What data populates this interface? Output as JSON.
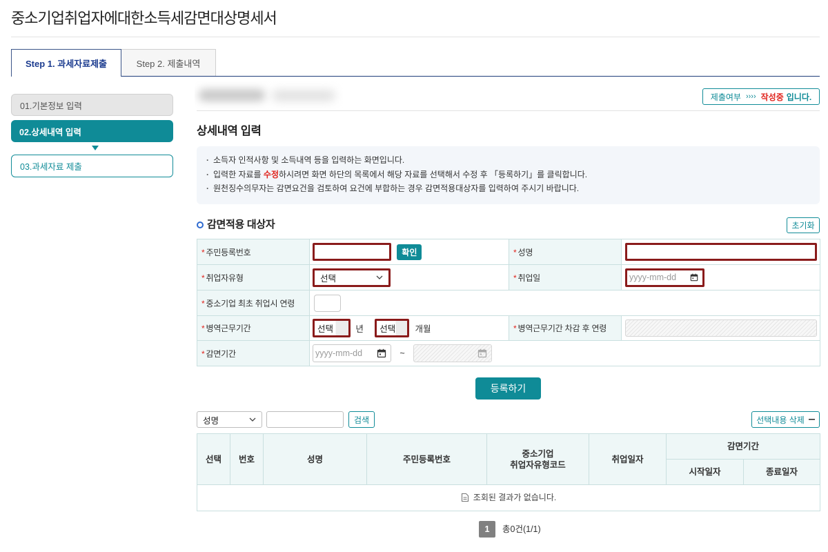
{
  "page": {
    "title": "중소기업취업자에대한소득세감면대상명세서"
  },
  "tabs": [
    {
      "label": "Step 1. 과세자료제출",
      "active": true
    },
    {
      "label": "Step 2. 제출내역",
      "active": false
    }
  ],
  "steps": [
    {
      "label": "01.기본정보 입력",
      "current": false
    },
    {
      "label": "02.상세내역 입력",
      "current": true
    },
    {
      "label": "03.과세자료 제출",
      "current": false
    }
  ],
  "status": {
    "label": "제출여부",
    "arrows": "››››",
    "value": "작성중",
    "suffix": "입니다."
  },
  "detail": {
    "heading": "상세내역 입력",
    "notice": {
      "line1": "소득자 인적사항 및 소득내역 등을 입력하는 화면입니다.",
      "line2_a": "입력한 자료를 ",
      "line2_highlight": "수정",
      "line2_b": "하시려면 화면 하단의 목록에서 해당 자료를 선택해서 수정 후 「등록하기」를 클릭합니다.",
      "line3": "원천징수의무자는 감면요건을 검토하여 요건에 부합하는 경우 감면적용대상자를 입력하여 주시기 바랍니다."
    }
  },
  "form": {
    "section_title": "감면적용 대상자",
    "reset_label": "초기화",
    "required_mark": "*",
    "rrn": {
      "label": "주민등록번호",
      "value": "",
      "confirm_label": "확인"
    },
    "name": {
      "label": "성명",
      "value": ""
    },
    "employee_type": {
      "label": "취업자유형",
      "selected": "선택"
    },
    "hire_date": {
      "label": "취업일",
      "placeholder": "yyyy-mm-dd"
    },
    "first_hire_age": {
      "label": "중소기업 최초 취업시 연령",
      "value": ""
    },
    "military": {
      "label": "병역근무기간",
      "years_selected": "선택",
      "years_unit": "년",
      "months_selected": "선택",
      "months_unit": "개월"
    },
    "age_after_military": {
      "label": "병역근무기간 차감 후 연령",
      "value": ""
    },
    "reduction_period": {
      "label": "감면기간",
      "start_placeholder": "yyyy-mm-dd",
      "separator": "~"
    },
    "submit_label": "등록하기"
  },
  "search": {
    "field_selected": "성명",
    "query": "",
    "button_label": "검색",
    "delete_label": "선택내용 삭제"
  },
  "results": {
    "columns": {
      "select": "선택",
      "no": "번호",
      "name": "성명",
      "rrn": "주민등록번호",
      "type_code_line1": "중소기업",
      "type_code_line2": "취업자유형코드",
      "hire_date": "취업일자",
      "period": "감면기간",
      "period_start": "시작일자",
      "period_end": "종료일자"
    },
    "rows": [],
    "empty_message": "조회된 결과가 없습니다."
  },
  "pagination": {
    "current": 1,
    "summary": "총0건(1/1)"
  },
  "icons": {
    "calendar": "calendar-icon",
    "dropdown": "chevron-down-icon",
    "section_bullet": "circle-bullet-icon",
    "empty": "document-icon",
    "delete": "minus-icon",
    "step_arrow": "triangle-down-icon"
  },
  "theme": {
    "primary": "#0f8b97",
    "navy": "#1f3d7a",
    "required": "#e0241d",
    "highlight_border": "#8a1b1b",
    "label_bg": "#eef7f7",
    "notice_bg": "#f3f6fa",
    "grid_border": "#c9dfdf"
  }
}
